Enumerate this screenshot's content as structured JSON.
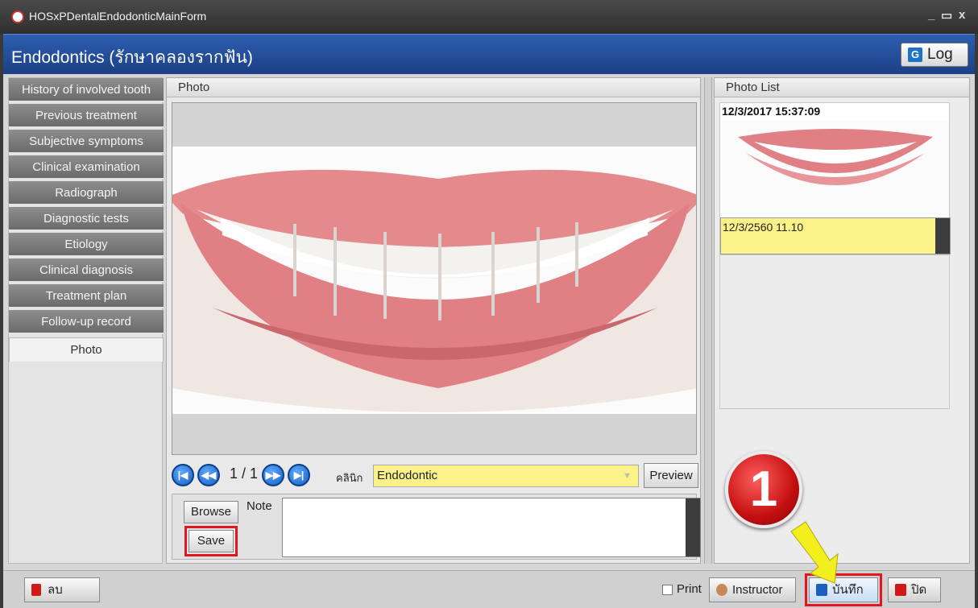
{
  "window": {
    "title": "HOSxPDentalEndodonticMainForm",
    "minimize": "_",
    "maximize": "▭",
    "close": "x"
  },
  "header": {
    "title": "Endodontics (รักษาคลองรากฟัน)",
    "log_label": "Log"
  },
  "tabs": [
    {
      "label": "History of involved tooth"
    },
    {
      "label": "Previous treatment"
    },
    {
      "label": "Subjective symptoms"
    },
    {
      "label": "Clinical examination"
    },
    {
      "label": "Radiograph"
    },
    {
      "label": "Diagnostic tests"
    },
    {
      "label": "Etiology"
    },
    {
      "label": "Clinical diagnosis"
    },
    {
      "label": "Treatment plan"
    },
    {
      "label": "Follow-up record"
    },
    {
      "label": "Photo"
    }
  ],
  "photo_panel": {
    "title": "Photo",
    "page": "1 / 1",
    "clinic_label": "คลินิก",
    "clinic_value": "Endodontic",
    "preview_label": "Preview",
    "browse_label": "Browse",
    "note_label": "Note",
    "save_label": "Save"
  },
  "photo_list": {
    "title": "Photo List",
    "items": [
      {
        "timestamp": "12/3/2017 15:37:09",
        "note": "12/3/2560 11.10"
      }
    ]
  },
  "footer": {
    "delete_label": "ลบ",
    "print_label": "Print",
    "instructor_label": "Instructor",
    "save_label": "บันทึก",
    "close_label": "ปิด"
  },
  "annotation": {
    "badge_number": "1"
  },
  "colors": {
    "accent_blue": "#1c3f85",
    "field_yellow": "#fbf38a",
    "highlight_red": "#e11620"
  }
}
